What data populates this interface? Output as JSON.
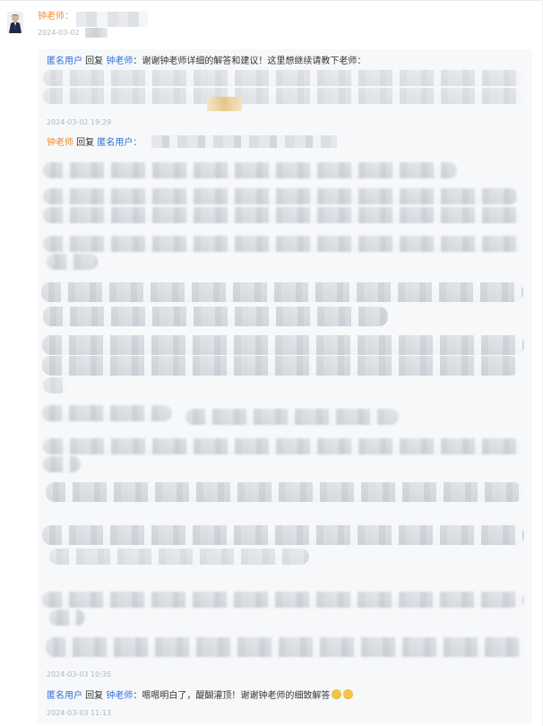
{
  "comments": {
    "top": {
      "author": "钟老师：",
      "date": "2024-03-02"
    },
    "replies": [
      {
        "author": "匿名用户",
        "verb": " 回复 ",
        "target": "钟老师",
        "text": "：谢谢钟老师详细的解答和建议！这里想继续请教下老师：",
        "date": "2024-03-02 19:29"
      },
      {
        "author": "钟老师",
        "verb": " 回复 ",
        "target": "匿名用户：",
        "date": "2024-03-03 10:35"
      },
      {
        "author": "匿名用户",
        "verb": " 回复 ",
        "target": "钟老师",
        "text": "：嗯嗯明白了，醍醐灌顶！谢谢钟老师的细致解答",
        "date": "2024-03-03 11:13"
      }
    ]
  },
  "colors": {
    "accent_orange": "#f08d34",
    "accent_blue": "#2f70d8",
    "reply_background": "#f7f8fa",
    "date_gray": "#b1b7c0"
  },
  "icons": [
    "avatar",
    "smile-emoji",
    "smile-emoji"
  ]
}
